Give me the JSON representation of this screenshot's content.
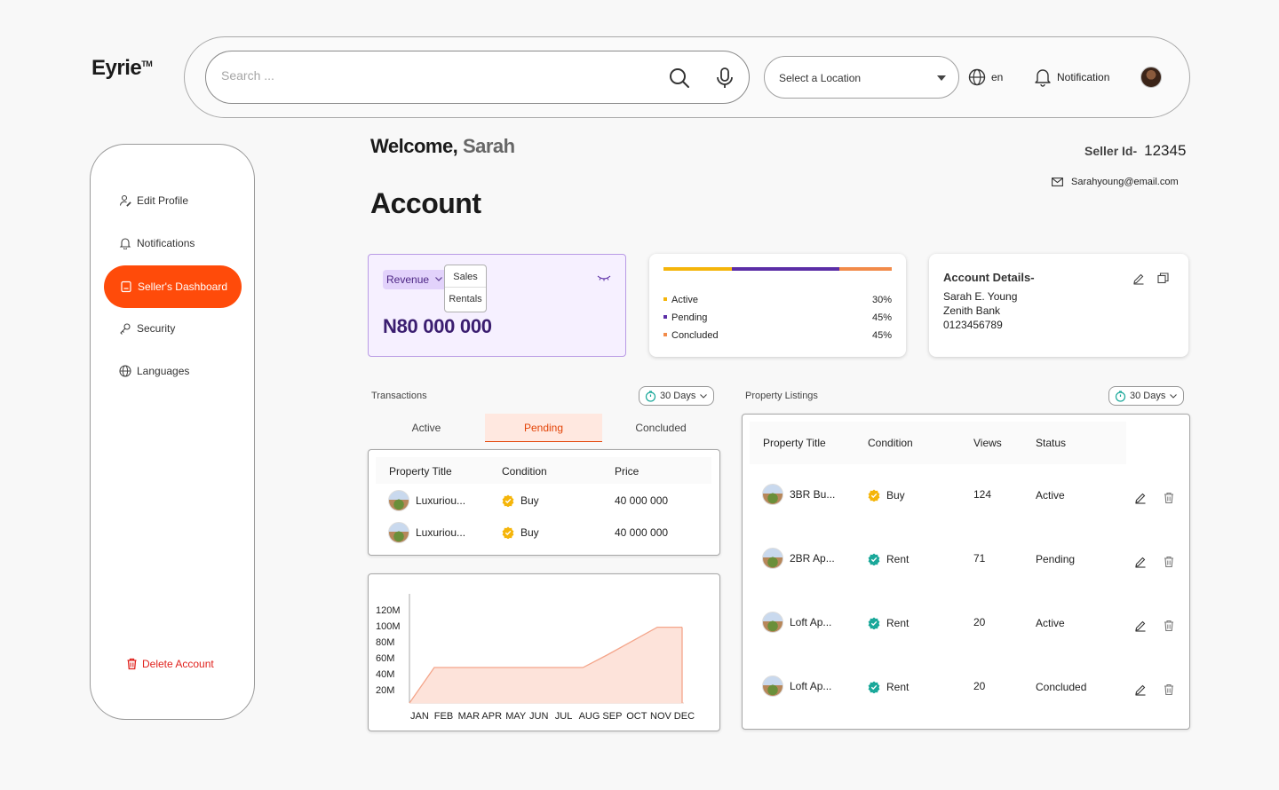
{
  "brand": {
    "logo": "Eyrie",
    "tm": "TM"
  },
  "header": {
    "search_placeholder": "Search ...",
    "location_label": "Select a Location",
    "language": "en",
    "notification_label": "Notification"
  },
  "sidebar": {
    "items": [
      {
        "label": "Edit Profile",
        "icon": "user-edit-icon"
      },
      {
        "label": "Notifications",
        "icon": "bell-icon"
      },
      {
        "label": "Seller's Dashboard",
        "icon": "dashboard-icon",
        "active": true
      },
      {
        "label": "Security",
        "icon": "key-icon"
      },
      {
        "label": "Languages",
        "icon": "globe-icon"
      }
    ],
    "delete_label": "Delete Account"
  },
  "welcome": {
    "greeting": "Welcome,",
    "name": "Sarah"
  },
  "page_title": "Account",
  "seller": {
    "id_label": "Seller Id-",
    "id_value": "12345",
    "email": "Sarahyoung@email.com"
  },
  "revenue": {
    "selected": "Revenue",
    "options": [
      "Sales",
      "Rentals"
    ],
    "amount": "N80 000 000"
  },
  "status_summary": {
    "rows": [
      {
        "label": "Active",
        "percent": "30%",
        "color": "#f5b50a"
      },
      {
        "label": "Pending",
        "percent": "45%",
        "color": "#5b2ea6"
      },
      {
        "label": "Concluded",
        "percent": "45%",
        "color": "#f28b4a"
      }
    ]
  },
  "account_details": {
    "title": "Account Details-",
    "name": "Sarah E. Young",
    "bank": "Zenith Bank",
    "account_number": "0123456789"
  },
  "transactions": {
    "label": "Transactions",
    "range": "30 Days",
    "tabs": [
      "Active",
      "Pending",
      "Concluded"
    ],
    "active_tab": "Pending",
    "columns": [
      "Property Title",
      "Condition",
      "Price"
    ],
    "rows": [
      {
        "title": "Luxuriou...",
        "condition": "Buy",
        "price": "40 000 000"
      },
      {
        "title": "Luxuriou...",
        "condition": "Buy",
        "price": "40 000 000"
      }
    ]
  },
  "chart_data": {
    "type": "area",
    "categories": [
      "JAN",
      "FEB",
      "MAR",
      "APR",
      "MAY",
      "JUN",
      "JUL",
      "AUG",
      "SEP",
      "OCT",
      "NOV",
      "DEC"
    ],
    "y_ticks": [
      "120M",
      "100M",
      "80M",
      "60M",
      "40M",
      "20M"
    ],
    "series": [
      {
        "values": [
          0,
          44,
          44,
          44,
          44,
          44,
          44,
          44,
          60,
          77,
          94,
          94
        ]
      }
    ],
    "ylim": [
      0,
      120
    ],
    "title": "",
    "xlabel": "",
    "ylabel": "",
    "fill_color": "#fde3da",
    "line_color": "#f4a58a"
  },
  "listings": {
    "label": "Property Listings",
    "range": "30 Days",
    "columns": [
      "Property Title",
      "Condition",
      "Views",
      "Status"
    ],
    "rows": [
      {
        "title": "3BR Bu...",
        "condition": "Buy",
        "views": "124",
        "status": "Active"
      },
      {
        "title": "2BR Ap...",
        "condition": "Rent",
        "views": "71",
        "status": "Pending"
      },
      {
        "title": "Loft Ap...",
        "condition": "Rent",
        "views": "20",
        "status": "Active"
      },
      {
        "title": "Loft Ap...",
        "condition": "Rent",
        "views": "20",
        "status": "Concluded"
      }
    ]
  },
  "colors": {
    "accent": "#ff4b0a",
    "purple": "#3b1e70",
    "danger": "#e0211c",
    "rent_badge": "#1aa89a",
    "buy_badge": "#f5b50a"
  }
}
